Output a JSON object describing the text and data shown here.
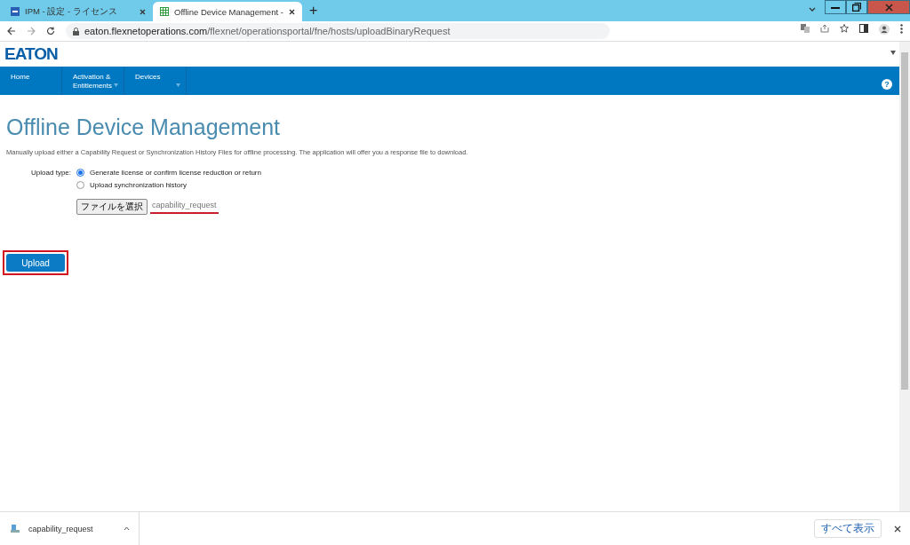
{
  "browser": {
    "tabs": [
      {
        "title": "IPM - 設定 - ライセンス",
        "selected": false
      },
      {
        "title": "Offline Device Management -",
        "selected": true
      }
    ],
    "new_tab": "+",
    "address": {
      "domain": "eaton.flexnetoperations.com",
      "path": "/flexnet/operationsportal/fne/hosts/uploadBinaryRequest"
    }
  },
  "page": {
    "logo": "EATON",
    "nav": [
      {
        "label": "Home",
        "dropdown": false
      },
      {
        "label": "Activation & Entitlements",
        "dropdown": true
      },
      {
        "label": "Devices",
        "dropdown": true
      }
    ],
    "help": "?",
    "title": "Offline Device Management",
    "description": "Manually upload either a Capability Request or Synchronization History Files for offline processing. The application will offer you a response file to download.",
    "upload_type_label": "Upload type:",
    "options": [
      {
        "label": "Generate license or confirm license reduction or return",
        "selected": true
      },
      {
        "label": "Upload synchronization history",
        "selected": false
      }
    ],
    "file_button": "ファイルを選択",
    "file_name": "capability_request",
    "upload_button": "Upload"
  },
  "download_bar": {
    "file": "capability_request",
    "show_all": "すべて表示"
  }
}
